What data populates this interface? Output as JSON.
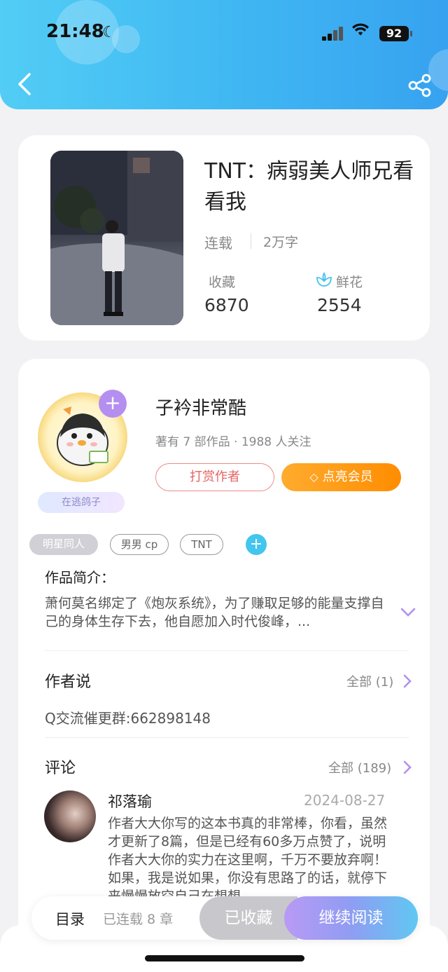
{
  "status_bar": {
    "time": "21:48",
    "battery": "92"
  },
  "book": {
    "title": "TNT：病弱美人师兄看看我",
    "status": "连载",
    "word_count": "2万字",
    "favorites_label": "收藏",
    "favorites_count": "6870",
    "flowers_label": "鲜花",
    "flowers_count": "2554"
  },
  "author": {
    "name": "子衿非常酷",
    "meta": "著有 7 部作品 · 1988 人关注",
    "badge": "在逃鸽子",
    "reward_label": "打赏作者",
    "member_label": "点亮会员"
  },
  "tags": [
    "明星同人",
    "男男 cp",
    "TNT"
  ],
  "intro": {
    "label": "作品简介：",
    "text": "萧何莫名绑定了《炮灰系统》，为了赚取足够的能量支撑自己的身体生存下去，他自愿加入时代俊峰，..."
  },
  "author_says": {
    "title": "作者说",
    "link": "全部 (1)",
    "text": "Q交流催更群:662898148"
  },
  "comments": {
    "title": "评论",
    "link": "全部 (189)",
    "items": [
      {
        "user": "祁落瑜",
        "date": "2024-08-27",
        "text": "作者大大你写的这本书真的非常棒，你看，虽然才更新了8篇，但是已经有60多万点赞了，说明作者大大你的实力在这里啊，千万不要放弃啊！如果，我是说如果，你没有思路了的话，就停下来慢慢放空自己在想想"
      }
    ]
  },
  "bottom_bar": {
    "toc_label": "目录",
    "chapters_label": "已连载 8 章",
    "collected_label": "已收藏",
    "continue_label": "继续阅读"
  },
  "colors": {
    "header_start": "#52cdf5",
    "header_end": "#37a2f0",
    "accent_purple": "#b48ff0",
    "reward_red": "#e76464",
    "member_orange": "#ff9a12"
  }
}
